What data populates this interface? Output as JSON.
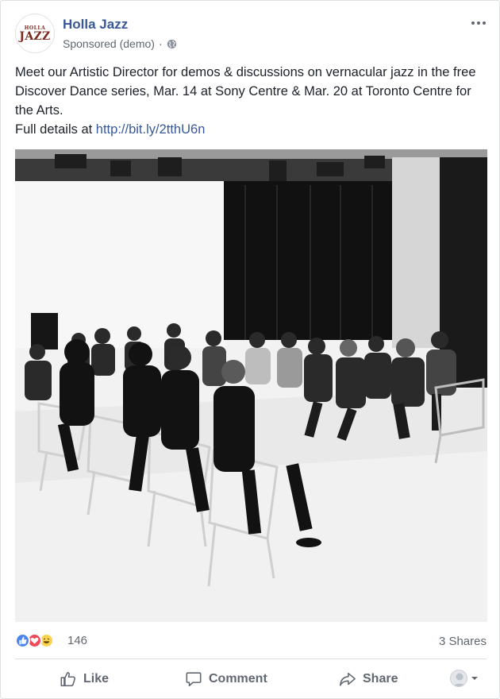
{
  "post": {
    "page_name": "Holla Jazz",
    "avatar_logo": {
      "line1": "HOLLA",
      "line2": "JAZZ"
    },
    "sponsored_label": "Sponsored (demo)",
    "separator": "·",
    "audience_icon": "globe-icon",
    "more_icon": "more-options-icon",
    "body_text": "Meet our Artistic Director for demos & discussions on vernacular jazz in the free Discover Dance series, Mar. 14 at Sony Centre & Mar. 20 at Toronto Centre for the Arts.",
    "details_prefix": "Full details at ",
    "details_link": "http://bit.ly/2tthU6n",
    "image_icon": "dance-workshop-photo"
  },
  "stats": {
    "reaction_icons": [
      "like-reaction-icon",
      "love-reaction-icon",
      "haha-reaction-icon"
    ],
    "reaction_count": "146",
    "shares": "3 Shares"
  },
  "actions": {
    "like_label": "Like",
    "comment_label": "Comment",
    "share_label": "Share",
    "viewer_icon": "viewer-avatar-icon",
    "dropdown_icon": "caret-down-icon"
  },
  "colors": {
    "link": "#385898",
    "secondary_text": "#606770",
    "like_blue": "#4b86f0",
    "love_red": "#f0485a",
    "haha_yellow": "#fcd34f"
  }
}
